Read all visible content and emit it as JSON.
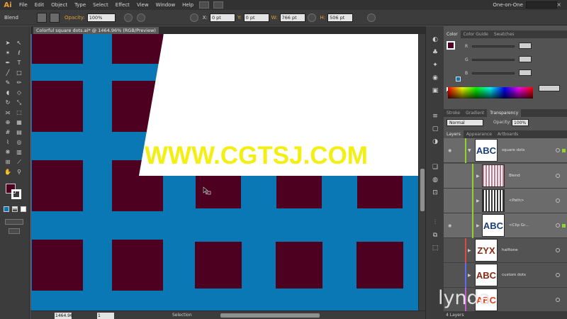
{
  "app": {
    "logo": "Ai",
    "menus": [
      "File",
      "Edit",
      "Object",
      "Type",
      "Select",
      "Effect",
      "View",
      "Window",
      "Help"
    ],
    "workspace": "One-on-One"
  },
  "control_bar": {
    "selection_type": "Blend",
    "opacity_label": "Opacity:",
    "opacity_value": "100%",
    "x_label": "X:",
    "x_value": "0 pt",
    "y_label": "Y:",
    "y_value": "0 pt",
    "w_label": "W:",
    "w_value": "766 pt",
    "h_label": "H:",
    "h_value": "506 pt"
  },
  "document": {
    "tab_label": "Colorful square dots.ai* @ 1464.96% (RGB/Preview)",
    "watermark": "WWW.CGTSJ.COM",
    "square_color": "#4e0021",
    "background_color": "#0a78b5"
  },
  "status_bar": {
    "zoom": "1464.96",
    "artboard": "1",
    "tool_name": "Selection"
  },
  "color_panel": {
    "tabs": [
      "Color",
      "Color Guide",
      "Swatches"
    ],
    "channels": [
      "R",
      "G",
      "B"
    ]
  },
  "transparency_panel": {
    "tabs": [
      "Stroke",
      "Gradient",
      "Transparency"
    ],
    "blend_mode": "Normal",
    "opacity_label": "Opacity:",
    "opacity_value": "100%"
  },
  "layers_panel": {
    "tabs": [
      "Layers",
      "Appearance",
      "Artboards"
    ],
    "rows": [
      {
        "name": "square dots",
        "thumb_text": "ABC",
        "thumb_color": "#1d3f7a",
        "accent": "#8fd32b"
      },
      {
        "name": "Blend",
        "thumb_text": "",
        "thumb_color": "#c9748a",
        "accent": "#8fd32b"
      },
      {
        "name": "<Path>",
        "thumb_text": "",
        "thumb_color": "#333333",
        "accent": "#8fd32b"
      },
      {
        "name": "<Clip Gr...",
        "thumb_text": "ABC",
        "thumb_color": "#1d3f7a",
        "accent": "#8fd32b"
      },
      {
        "name": "halftone",
        "thumb_text": "ZYX",
        "thumb_color": "#8a2a12",
        "accent": "#e04848"
      },
      {
        "name": "custom dots",
        "thumb_text": "ABC",
        "thumb_color": "#8a2a12",
        "accent": "#5a6cf0"
      },
      {
        "name": "",
        "thumb_text": "ABC",
        "thumb_color": "#e0401a",
        "accent": "#c458d0"
      }
    ],
    "footer_count": "4 Layers"
  },
  "brand": {
    "text": "lynda"
  }
}
